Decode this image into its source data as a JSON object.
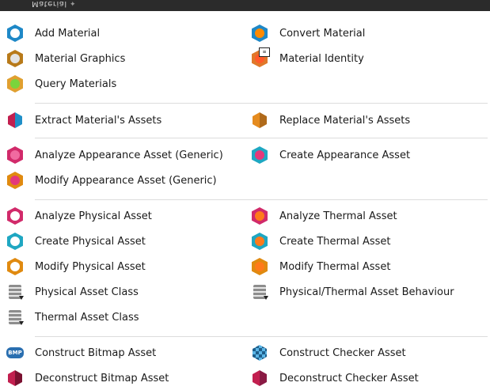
{
  "panel": {
    "title": "Material"
  },
  "groups": [
    {
      "items": [
        {
          "label": "Add Material",
          "icon": "add-material-icon",
          "color": "#ffffff"
        },
        {
          "label": "Convert Material",
          "icon": "convert-material-icon",
          "color": "#ff8a00"
        },
        {
          "label": "Material Graphics",
          "icon": "material-graphics-icon",
          "color": "#d9d9d9"
        },
        {
          "label": "Material Identity",
          "icon": "material-identity-icon",
          "color": "#ff5a2a"
        },
        {
          "label": "Query Materials",
          "icon": "query-materials-icon",
          "color": "#7ad43c"
        }
      ]
    },
    {
      "items": [
        {
          "label": "Extract Material's Assets",
          "icon": "extract-assets-icon",
          "color": "#c21f4f"
        },
        {
          "label": "Replace Material's Assets",
          "icon": "replace-assets-icon",
          "color": "#e58b1f"
        }
      ]
    },
    {
      "items": [
        {
          "label": "Analyze Appearance Asset (Generic)",
          "icon": "analyze-appearance-icon",
          "color": "#e4387a"
        },
        {
          "label": "Create Appearance Asset",
          "icon": "create-appearance-icon",
          "color": "#e4387a"
        },
        {
          "label": "Modify Appearance Asset (Generic)",
          "icon": "modify-appearance-icon",
          "color": "#e4387a"
        }
      ]
    },
    {
      "items": [
        {
          "label": "Analyze Physical Asset",
          "icon": "analyze-physical-icon",
          "color": "#ffffff"
        },
        {
          "label": "Analyze Thermal Asset",
          "icon": "analyze-thermal-icon",
          "color": "#ff7a1a"
        },
        {
          "label": "Create Physical Asset",
          "icon": "create-physical-icon",
          "color": "#ffffff"
        },
        {
          "label": "Create Thermal Asset",
          "icon": "create-thermal-icon",
          "color": "#ff7a1a"
        },
        {
          "label": "Modify Physical Asset",
          "icon": "modify-physical-icon",
          "color": "#ffffff"
        },
        {
          "label": "Modify Thermal Asset",
          "icon": "modify-thermal-icon",
          "color": "#ff7a1a"
        },
        {
          "label": "Physical Asset Class",
          "icon": "physical-asset-class-icon",
          "color": "#8d8d8d"
        },
        {
          "label": "Physical/Thermal Asset Behaviour",
          "icon": "asset-behaviour-icon",
          "color": "#8d8d8d"
        },
        {
          "label": "Thermal Asset Class",
          "icon": "thermal-asset-class-icon",
          "color": "#8d8d8d"
        }
      ]
    },
    {
      "items": [
        {
          "label": "Construct Bitmap Asset",
          "icon": "construct-bitmap-icon",
          "color": "#2a6fb0",
          "tag": "BMP"
        },
        {
          "label": "Construct Checker Asset",
          "icon": "construct-checker-icon",
          "color": "#1f5f8b"
        },
        {
          "label": "Deconstruct Bitmap Asset",
          "icon": "deconstruct-bitmap-icon",
          "color": "#c21f4f"
        },
        {
          "label": "Deconstruct Checker Asset",
          "icon": "deconstruct-checker-icon",
          "color": "#c21f4f"
        }
      ]
    }
  ],
  "theme": {
    "material_blue": "#1e88c7",
    "material_magenta": "#d12a6a",
    "material_teal": "#1fa7c2",
    "material_orange": "#e08a10",
    "separator": "#dcdcdc"
  }
}
